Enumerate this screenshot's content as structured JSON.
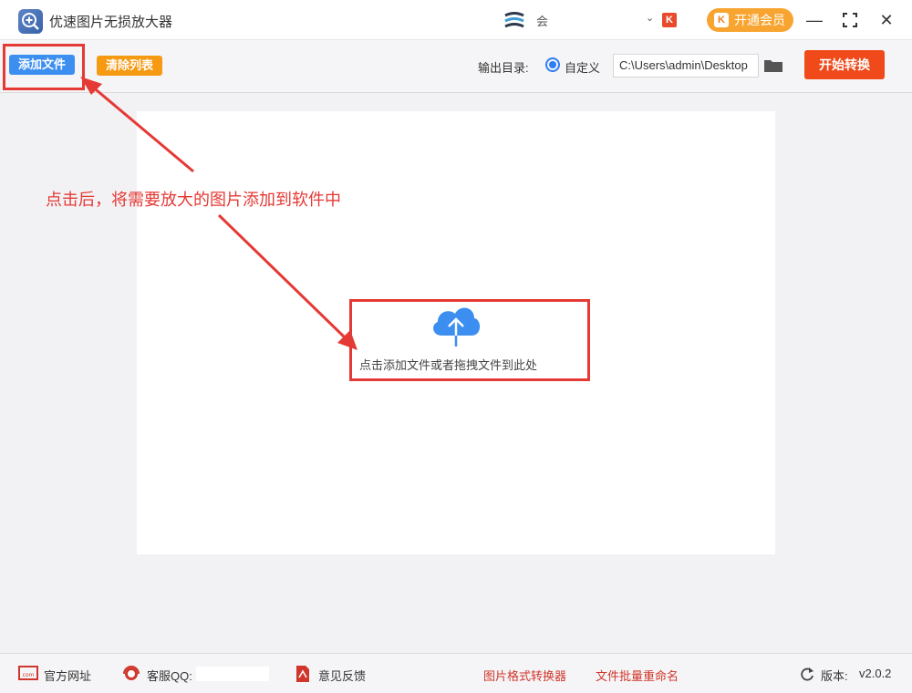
{
  "titlebar": {
    "app_title": "优速图片无损放大器",
    "user_name": "会",
    "user_id": "",
    "chevron": "⌄",
    "vip_mark": "K",
    "vip_button": "开通会员",
    "minimize": "—",
    "maximize": "⤢",
    "close": "✕"
  },
  "toolbar": {
    "add_files": "添加文件",
    "clear_list": "清除列表",
    "output_dir_label": "输出目录:",
    "radio_custom": "自定义",
    "output_path": "C:\\Users\\admin\\Desktop",
    "start_button": "开始转换"
  },
  "main": {
    "drop_text": "点击添加文件或者拖拽文件到此处",
    "annotation": "点击后，将需要放大的图片添加到软件中"
  },
  "footer": {
    "website": "官方网址",
    "service_qq": "客服QQ:",
    "feedback": "意见反馈",
    "format_converter": "图片格式转换器",
    "batch_rename": "文件批量重命名",
    "version_label": "版本:",
    "version": "v2.0.2"
  },
  "colors": {
    "primary_blue": "#3c8ff0",
    "clear_orange": "#f59a12",
    "start_red": "#f04a1a",
    "vip_orange": "#f7a530",
    "annotation_red": "#e53935"
  }
}
